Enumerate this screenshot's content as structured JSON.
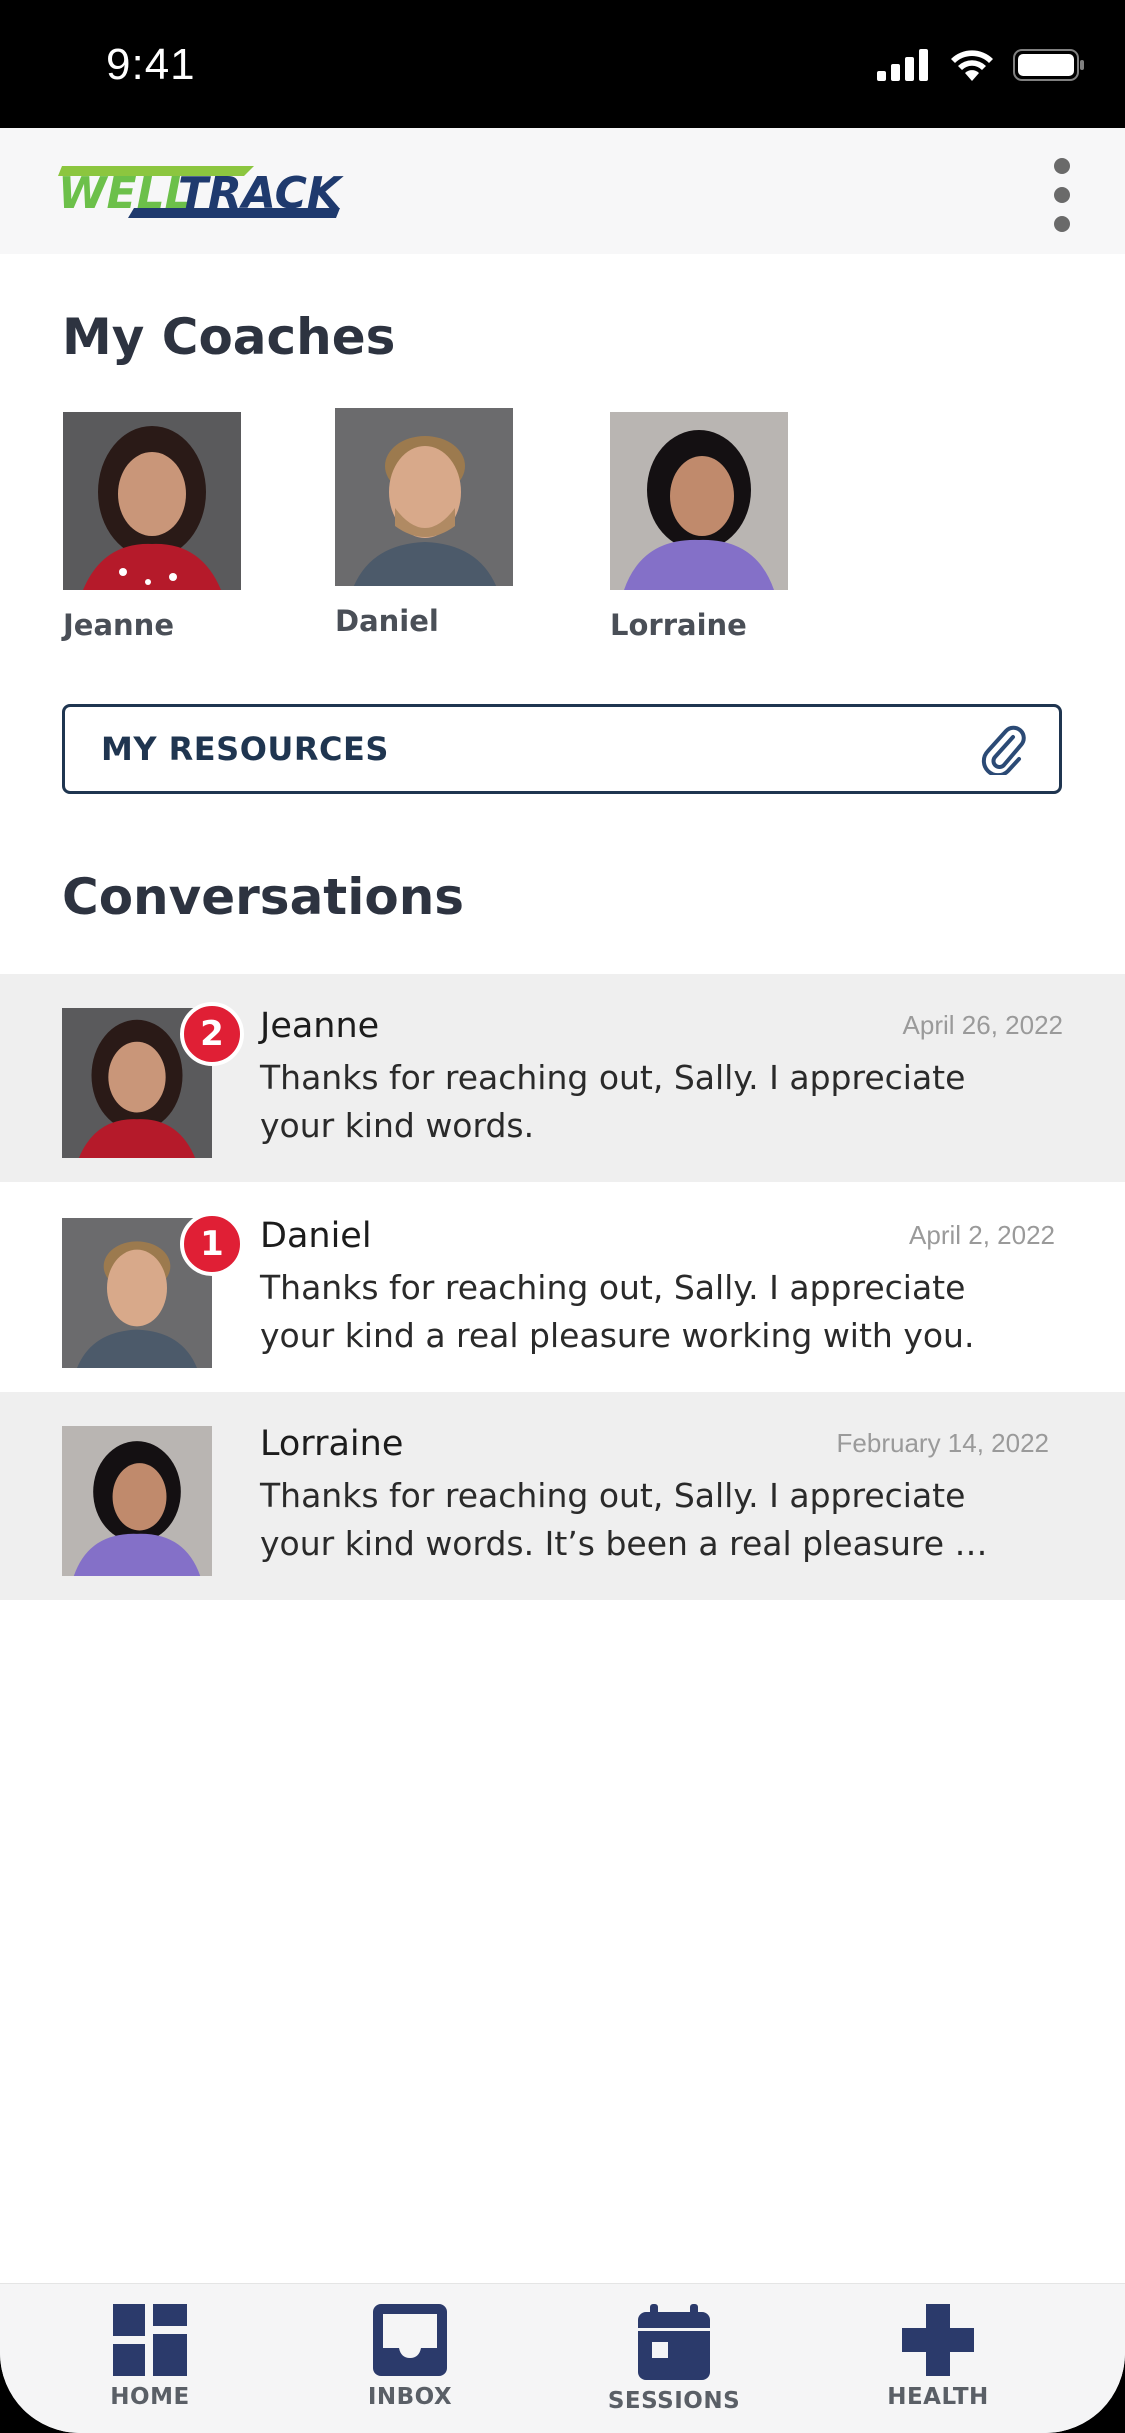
{
  "status_bar": {
    "time": "9:41",
    "icons": [
      "signal-icon",
      "wifi-icon",
      "battery-icon"
    ]
  },
  "header": {
    "logo_text": "WELLTRACK",
    "menu_icon": "more-vertical-icon"
  },
  "coaches": {
    "title": "My Coaches",
    "items": [
      {
        "name": "Jeanne"
      },
      {
        "name": "Daniel"
      },
      {
        "name": "Lorraine"
      }
    ]
  },
  "resources": {
    "label": "MY RESOURCES",
    "icon": "paperclip-icon"
  },
  "conversations": {
    "title": "Conversations",
    "items": [
      {
        "name": "Jeanne",
        "date": "April 26, 2022",
        "badge": "2",
        "message": "Thanks for reaching out, Sally. I appreciate your kind words."
      },
      {
        "name": "Daniel",
        "date": "April 2, 2022",
        "badge": "1",
        "message": "Thanks for reaching out, Sally. I appreciate your kind a real pleasure working with you."
      },
      {
        "name": "Lorraine",
        "date": "February 14, 2022",
        "badge": "",
        "message": "Thanks for reaching out, Sally. I appreciate your kind words. It’s been a real pleasure …"
      }
    ]
  },
  "tabs": [
    {
      "label": "HOME",
      "icon": "dashboard-icon"
    },
    {
      "label": "INBOX",
      "icon": "inbox-icon"
    },
    {
      "label": "SESSIONS",
      "icon": "calendar-icon"
    },
    {
      "label": "HEALTH",
      "icon": "health-cross-icon"
    }
  ],
  "colors": {
    "brand_navy": "#1f3550",
    "brand_green": "#6cc04a",
    "badge_red": "#e01f35",
    "tab_icon": "#2b3a6b"
  }
}
